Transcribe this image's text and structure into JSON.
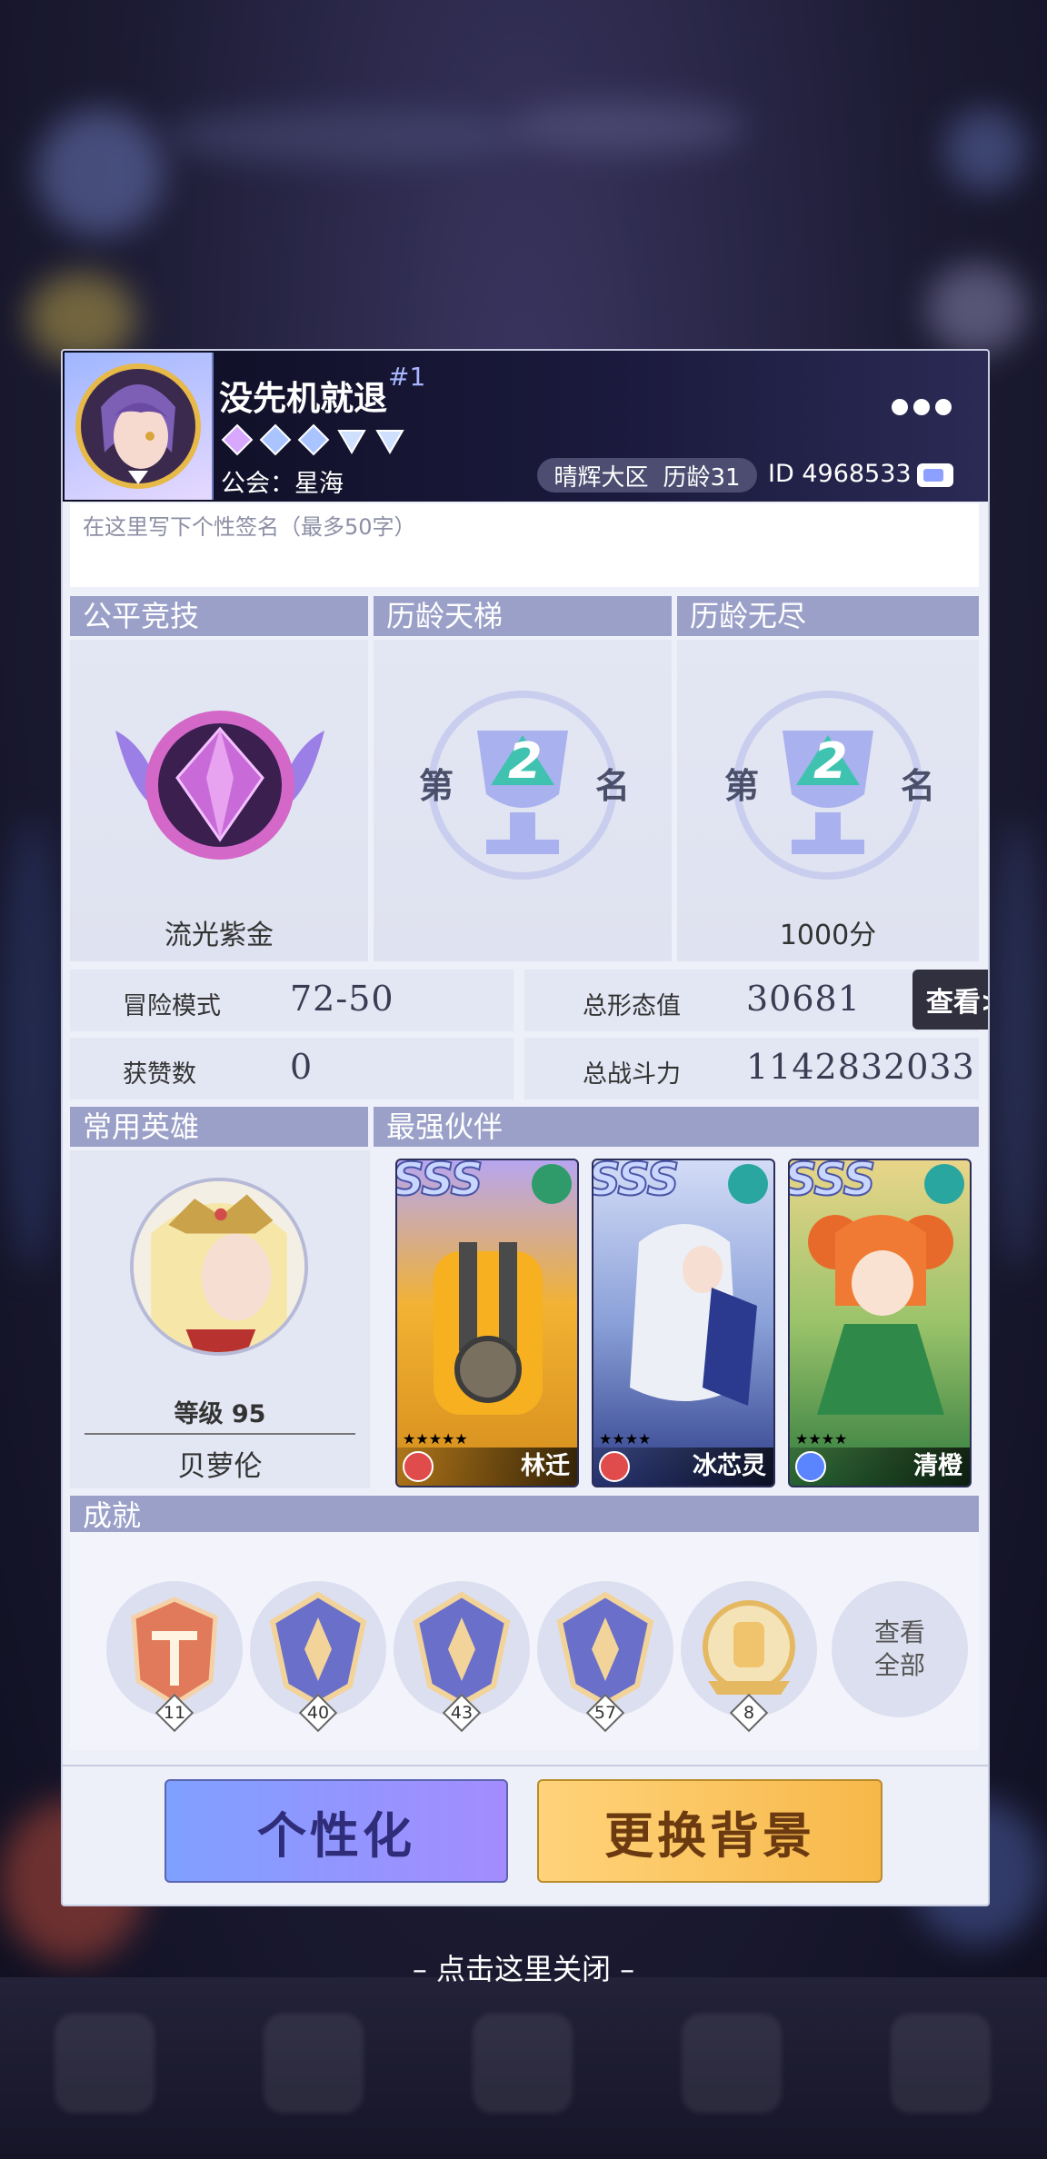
{
  "profile": {
    "name": "没先机就退",
    "rank_tag": "#1",
    "guild": "公会：星海",
    "region": "晴辉大区",
    "age": "历龄31",
    "id": "ID 4968533"
  },
  "signature_placeholder": "在这里写下个性签名（最多50字）",
  "sections": {
    "fair_arena": "公平竞技",
    "ladder": "历龄天梯",
    "endless": "历龄无尽",
    "common_hero": "常用英雄",
    "best_partner": "最强伙伴",
    "achievements": "成就"
  },
  "ranks": {
    "fair_arena_label": "流光紫金",
    "ladder_prefix": "第",
    "ladder_num": "2",
    "ladder_suffix": "名",
    "endless_prefix": "第",
    "endless_num": "2",
    "endless_suffix": "名",
    "endless_score": "1000分"
  },
  "stats": {
    "adventure_label": "冒险模式",
    "adventure_value": "72-50",
    "likes_label": "获赞数",
    "likes_value": "0",
    "form_label": "总形态值",
    "form_value": "30681",
    "power_label": "总战斗力",
    "power_value": "1142832033",
    "view_button": "查看>>"
  },
  "hero": {
    "level": "等级 95",
    "name": "贝萝伦"
  },
  "partners": [
    {
      "grade": "SSS",
      "name": "林迁",
      "stars": "★★★★★",
      "element_color": "#2f9b6b",
      "role_color": "#e04c4c"
    },
    {
      "grade": "SSS",
      "name": "冰芯灵",
      "stars": "★★★★",
      "element_color": "#2aa6a0",
      "role_color": "#e04c4c"
    },
    {
      "grade": "SSS",
      "name": "清橙",
      "stars": "★★★★",
      "element_color": "#2aa6a0",
      "role_color": "#5b84ff"
    }
  ],
  "achievements": {
    "badges": [
      "11",
      "40",
      "43",
      "57",
      "8"
    ],
    "view_all_line1": "查看",
    "view_all_line2": "全部"
  },
  "buttons": {
    "customize": "个性化",
    "change_bg": "更换背景"
  },
  "close_hint": "– 点击这里关闭 –",
  "colors": {
    "section_header": "#9aa0c8",
    "header_bg": "#14132e",
    "customize_btn": "#8f98ff",
    "bg_btn": "#f7c35e"
  }
}
